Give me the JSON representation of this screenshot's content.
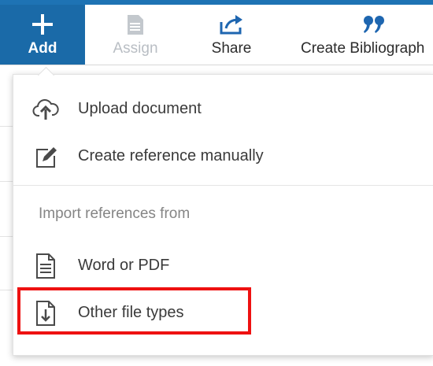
{
  "toolbar": {
    "add": {
      "label": "Add",
      "icon": "plus-icon"
    },
    "assign": {
      "label": "Assign",
      "icon": "document-icon",
      "disabled": true
    },
    "share": {
      "label": "Share",
      "icon": "share-icon"
    },
    "bibliography": {
      "label": "Create Bibliograph",
      "icon": "quote-icon"
    }
  },
  "menu": {
    "items": [
      {
        "label": "Upload document",
        "icon": "cloud-upload-icon"
      },
      {
        "label": "Create reference manually",
        "icon": "edit-icon"
      }
    ],
    "section_label": "Import references from",
    "import_items": [
      {
        "label": "Word or PDF",
        "icon": "text-document-icon"
      },
      {
        "label": "Other file types",
        "icon": "file-download-icon",
        "highlighted": true
      }
    ]
  },
  "colors": {
    "accent": "#1a6aa8",
    "highlight": "#ee1111",
    "bibliography_icon": "#1e66b0"
  }
}
